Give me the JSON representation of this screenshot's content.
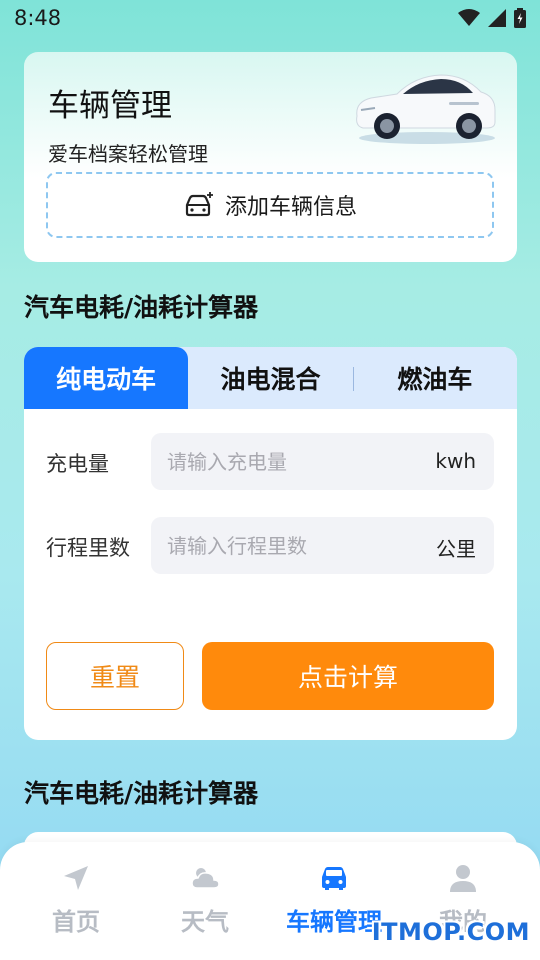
{
  "status_bar": {
    "time": "8:48"
  },
  "header_card": {
    "title": "车辆管理",
    "subtitle": "爱车档案轻松管理",
    "add_button_label": "添加车辆信息"
  },
  "section1": {
    "title": "汽车电耗/油耗计算器"
  },
  "calculator": {
    "tabs": [
      {
        "label": "纯电动车",
        "active": true
      },
      {
        "label": "油电混合",
        "active": false
      },
      {
        "label": "燃油车",
        "active": false
      }
    ],
    "fields": [
      {
        "label": "充电量",
        "placeholder": "请输入充电量",
        "value": "",
        "unit": "kwh"
      },
      {
        "label": "行程里数",
        "placeholder": "请输入行程里数",
        "value": "",
        "unit": "公里"
      }
    ],
    "reset_label": "重置",
    "calc_label": "点击计算"
  },
  "section2": {
    "title": "汽车电耗/油耗计算器"
  },
  "bottom_nav": [
    {
      "label": "首页",
      "icon": "navigation-arrow-icon",
      "active": false
    },
    {
      "label": "天气",
      "icon": "cloud-sun-icon",
      "active": false
    },
    {
      "label": "车辆管理",
      "icon": "car-icon",
      "active": true
    },
    {
      "label": "我的",
      "icon": "user-icon",
      "active": false
    }
  ],
  "watermark": "ITMOP.COM",
  "colors": {
    "primary": "#1677ff",
    "accent": "#ff8a0c",
    "tab_bg": "#dbeafd"
  }
}
